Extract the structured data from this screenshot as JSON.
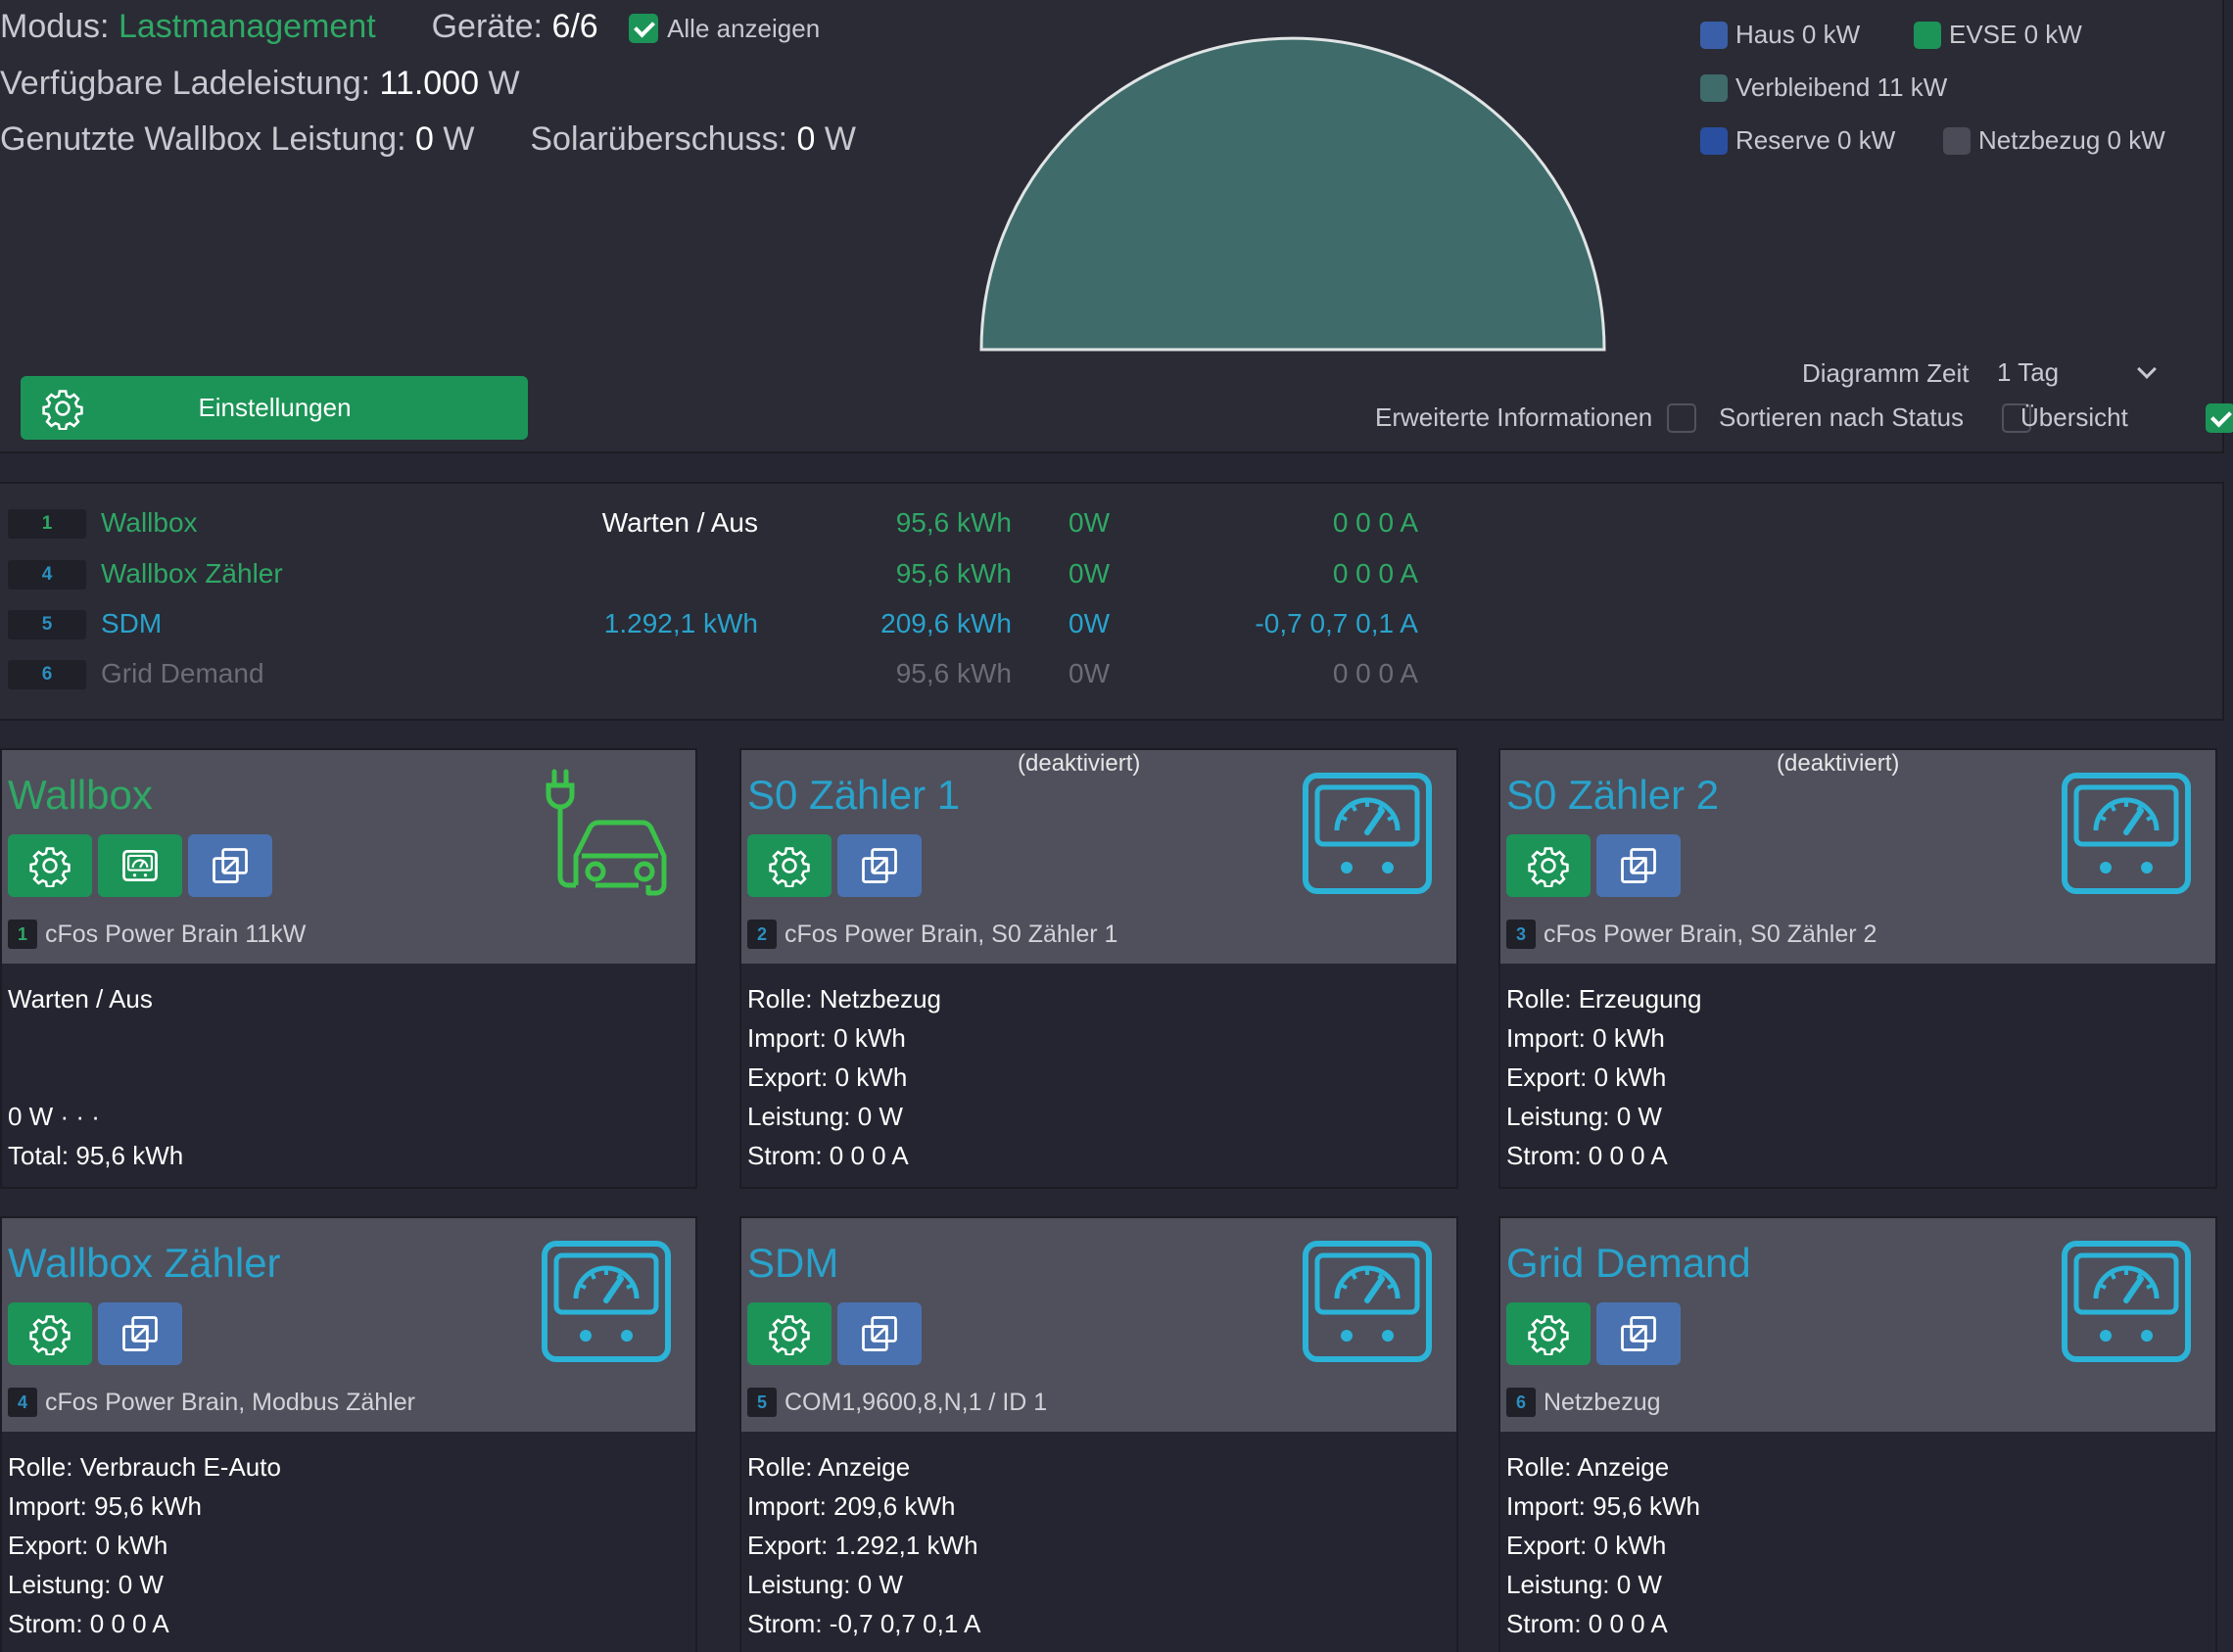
{
  "header": {
    "mode_label": "Modus:",
    "mode_value": "Lastmanagement",
    "devices_label": "Geräte:",
    "devices_value": "6/6",
    "show_all_label": "Alle anzeigen",
    "available_label": "Verfügbare Ladeleistung:",
    "available_value": "11.000",
    "available_unit": "W",
    "used_label": "Genutzte Wallbox Leistung:",
    "used_value": "0",
    "used_unit": "W",
    "solar_label": "Solarüberschuss:",
    "solar_value": "0",
    "solar_unit": "W",
    "settings_label": "Einstellungen"
  },
  "legend": [
    {
      "label": "Haus 0 kW",
      "color": "#3a5fa8"
    },
    {
      "label": "EVSE 0 kW",
      "color": "#1c9457"
    },
    {
      "label": "Verbleibend 11 kW",
      "color": "#3f6b6b"
    },
    {
      "label": "Reserve 0 kW",
      "color": "#2a4fa0"
    },
    {
      "label": "Netzbezug 0 kW",
      "color": "#4a4b56"
    }
  ],
  "gauge": {
    "remaining_fraction": 1.0,
    "fill": "#3f6b6b"
  },
  "options": {
    "diagram_time_label": "Diagramm Zeit",
    "diagram_time_value": "1 Tag",
    "extended_info_label": "Erweiterte Informationen",
    "sort_status_label": "Sortieren nach Status",
    "overview_label": "Übersicht"
  },
  "summary": [
    {
      "index": "1",
      "name": "Wallbox",
      "status": "Warten / Aus",
      "energy_total": "",
      "energy_import": "95,6 kWh",
      "power": "0W",
      "current": "0 0 0 A",
      "tone": "green"
    },
    {
      "index": "4",
      "name": "Wallbox Zähler",
      "status": "",
      "energy_total": "",
      "energy_import": "95,6 kWh",
      "power": "0W",
      "current": "0 0 0 A",
      "tone": "green"
    },
    {
      "index": "5",
      "name": "SDM",
      "status": "",
      "energy_total": "1.292,1 kWh",
      "energy_import": "209,6 kWh",
      "power": "0W",
      "current": "-0,7 0,7 0,1 A",
      "tone": "teal"
    },
    {
      "index": "6",
      "name": "Grid Demand",
      "status": "",
      "energy_total": "",
      "energy_import": "95,6 kWh",
      "power": "0W",
      "current": "0 0 0 A",
      "tone": "grey"
    }
  ],
  "cards": [
    {
      "title": "Wallbox",
      "deactivated": "",
      "index": "1",
      "subtitle": "cFos Power Brain 11kW",
      "lines": [
        "Warten / Aus",
        "",
        "",
        "0 W · · ·",
        "Total: 95,6 kWh"
      ]
    },
    {
      "title": "S0 Zähler 1",
      "deactivated": "(deaktiviert)",
      "index": "2",
      "subtitle": "cFos Power Brain, S0 Zähler 1",
      "lines": [
        "Rolle: Netzbezug",
        "Import: 0 kWh",
        "Export: 0 kWh",
        "Leistung: 0 W",
        "Strom: 0 0 0 A"
      ]
    },
    {
      "title": "S0 Zähler 2",
      "deactivated": "(deaktiviert)",
      "index": "3",
      "subtitle": "cFos Power Brain, S0 Zähler 2",
      "lines": [
        "Rolle: Erzeugung",
        "Import: 0 kWh",
        "Export: 0 kWh",
        "Leistung: 0 W",
        "Strom: 0 0 0 A"
      ]
    },
    {
      "title": "Wallbox Zähler",
      "deactivated": "",
      "index": "4",
      "subtitle": "cFos Power Brain, Modbus Zähler",
      "lines": [
        "Rolle: Verbrauch E-Auto",
        "Import: 95,6 kWh",
        "Export: 0 kWh",
        "Leistung: 0 W",
        "Strom: 0 0 0 A"
      ]
    },
    {
      "title": "SDM",
      "deactivated": "",
      "index": "5",
      "subtitle": "COM1,9600,8,N,1 / ID 1",
      "lines": [
        "Rolle: Anzeige",
        "Import: 209,6 kWh",
        "Export: 1.292,1 kWh",
        "Leistung: 0 W",
        "Strom: -0,7 0,7 0,1 A"
      ]
    },
    {
      "title": "Grid Demand",
      "deactivated": "",
      "index": "6",
      "subtitle": "Netzbezug",
      "lines": [
        "Rolle: Anzeige",
        "Import: 95,6 kWh",
        "Export: 0 kWh",
        "Leistung: 0 W",
        "Strom: 0 0 0 A"
      ]
    }
  ]
}
